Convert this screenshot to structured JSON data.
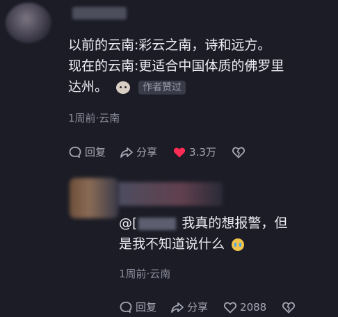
{
  "comment_main": {
    "line1": "以前的云南:彩云之南，诗和远方。",
    "line2": "现在的云南:更适合中国体质的佛罗里",
    "line3": "达州。",
    "author_badge": "作者赞过",
    "meta": "1周前·云南",
    "actions": {
      "reply": "回复",
      "share": "分享",
      "likes": "3.3万"
    }
  },
  "reply": {
    "mention_prefix": "@[",
    "text_line1": "我真的想报警，但",
    "text_line2": "是我不知道说什么",
    "meta": "1周前·云南",
    "actions": {
      "reply": "回复",
      "share": "分享",
      "likes": "2088"
    }
  },
  "colors": {
    "background": "#1b1c26",
    "like_active": "#ff2d55",
    "text_secondary": "#8c8d9c"
  }
}
